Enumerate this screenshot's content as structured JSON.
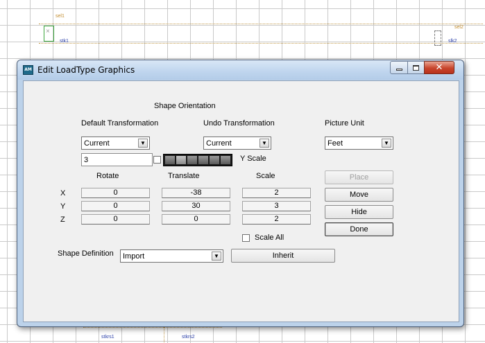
{
  "background": {
    "labels": [
      "sel1",
      "stk1",
      "sel2",
      "slk2",
      "stkrs1",
      "stkrs2"
    ]
  },
  "dialog": {
    "title": "Edit LoadType Graphics",
    "app_icon_text": "AM",
    "section_title": "Shape Orientation",
    "default_transformation": {
      "label": "Default Transformation",
      "value": "Current"
    },
    "undo_transformation": {
      "label": "Undo Transformation",
      "value": "Current"
    },
    "picture_unit": {
      "label": "Picture Unit",
      "value": "Feet"
    },
    "scale_input": {
      "value": "3"
    },
    "y_scale_label": "Y Scale",
    "columns": {
      "rotate": "Rotate",
      "translate": "Translate",
      "scale": "Scale"
    },
    "rows": [
      {
        "axis": "X",
        "rotate": "0",
        "translate": "-38",
        "scale": "2"
      },
      {
        "axis": "Y",
        "rotate": "0",
        "translate": "30",
        "scale": "3"
      },
      {
        "axis": "Z",
        "rotate": "0",
        "translate": "0",
        "scale": "2"
      }
    ],
    "scale_all_label": "Scale All",
    "shape_definition": {
      "label": "Shape Definition",
      "value": "Import"
    },
    "buttons": {
      "place": "Place",
      "move": "Move",
      "hide": "Hide",
      "done": "Done",
      "inherit": "Inherit"
    }
  }
}
